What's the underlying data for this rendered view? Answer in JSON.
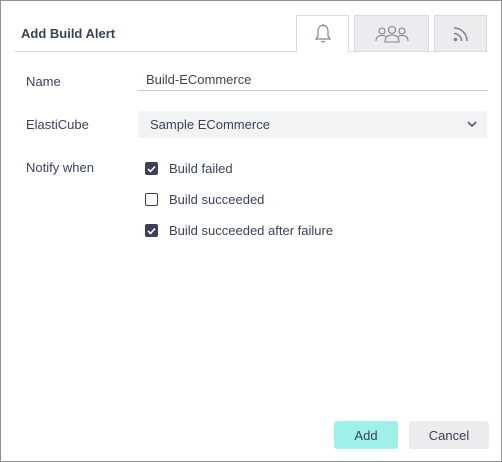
{
  "dialog": {
    "title": "Add Build Alert",
    "tabs": [
      {
        "icon": "bell-icon",
        "active": true
      },
      {
        "icon": "users-group-icon",
        "active": false
      },
      {
        "icon": "rss-feed-icon",
        "active": false
      }
    ]
  },
  "form": {
    "name_label": "Name",
    "name_value": "Build-ECommerce",
    "elasticube_label": "ElastiCube",
    "elasticube_value": "Sample ECommerce",
    "notify_label": "Notify when",
    "options": [
      {
        "label": "Build failed",
        "checked": true
      },
      {
        "label": "Build succeeded",
        "checked": false
      },
      {
        "label": "Build succeeded after failure",
        "checked": true
      }
    ]
  },
  "footer": {
    "add_label": "Add",
    "cancel_label": "Cancel"
  },
  "colors": {
    "accent": "#9ef0e8",
    "text": "#3a4356",
    "muted_bg": "#ececee"
  }
}
